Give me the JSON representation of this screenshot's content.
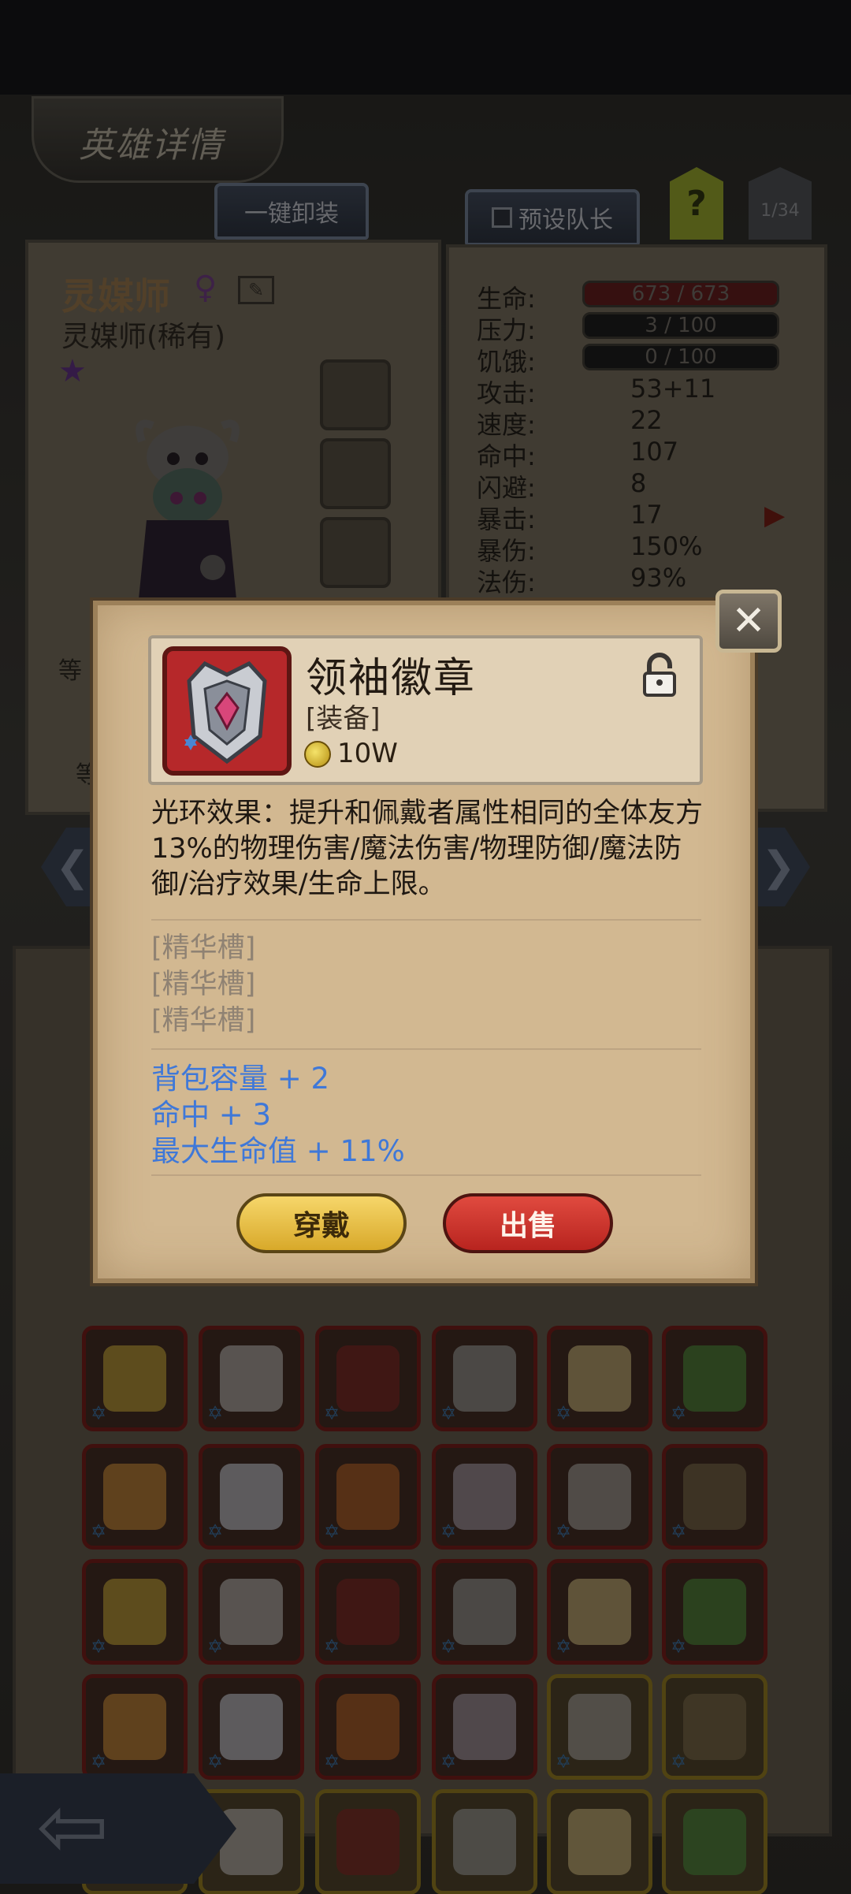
{
  "header": {
    "title": "英雄详情",
    "unequip_all": "一键卸装",
    "preset_captain": "预设队长",
    "help": "?",
    "page": "1/34"
  },
  "hero": {
    "name": "灵媒师",
    "class": "灵媒师(稀有)",
    "star": "★",
    "stats": [
      {
        "label": "生命:",
        "bar": "673 / 673",
        "bar_color": "#5d1c1d"
      },
      {
        "label": "压力:",
        "bar": "3 / 100",
        "bar_color": "#1c1c1c"
      },
      {
        "label": "饥饿:",
        "bar": "0 / 100",
        "bar_color": "#1c1c1c"
      },
      {
        "label": "攻击:",
        "value": "53+11"
      },
      {
        "label": "速度:",
        "value": "22"
      },
      {
        "label": "命中:",
        "value": "107"
      },
      {
        "label": "闪避:",
        "value": "8"
      },
      {
        "label": "暴击:",
        "value": "17"
      },
      {
        "label": "暴伤:",
        "value": "150%"
      },
      {
        "label": "法伤:",
        "value": "93%"
      }
    ],
    "side_labels": {
      "level1": "等",
      "level2": "等"
    }
  },
  "modal": {
    "item_name": "领袖徽章",
    "item_type": "[装备]",
    "price": "10W",
    "description": "光环效果：提升和佩戴者属性相同的全体友方13%的物理伤害/魔法伤害/物理防御/魔法防御/治疗效果/生命上限。",
    "sockets": [
      "[精华槽]",
      "[精华槽]",
      "[精华槽]"
    ],
    "bonuses": [
      "背包容量 + 2",
      "命中 + 3",
      "最大生命值 + 11%"
    ],
    "equip_label": "穿戴",
    "sell_label": "出售",
    "close_icon": "✕"
  },
  "nav": {
    "left_arrow": "❮",
    "right_arrow": "❯",
    "back_arrow": "⇦"
  },
  "colors": {
    "bonus_text": "#3f78d8",
    "sell_button": "#c8322b",
    "equip_button": "#e6bd45",
    "item_frame": "#b6282a"
  }
}
